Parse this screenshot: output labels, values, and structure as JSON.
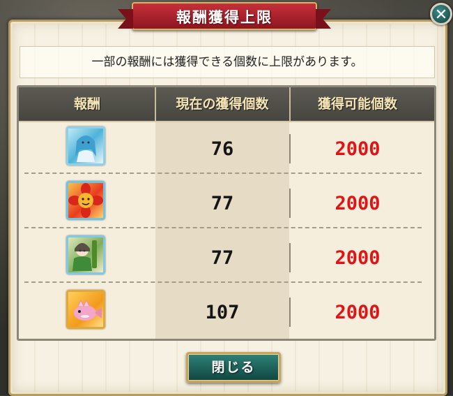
{
  "dialog": {
    "title": "報酬獲得上限",
    "notice": "一部の報酬には獲得できる個数に上限があります。",
    "close_button_label": "閉じる",
    "close_icon": "close-icon"
  },
  "table": {
    "headers": {
      "reward": "報酬",
      "current": "現在の獲得個数",
      "max": "獲得可能個数"
    },
    "rows": [
      {
        "icon": "blue-haired-maiden-card-icon",
        "current": "76",
        "max": "2000"
      },
      {
        "icon": "red-flower-creature-card-icon",
        "current": "77",
        "max": "2000"
      },
      {
        "icon": "green-hooded-girl-card-icon",
        "current": "77",
        "max": "2000"
      },
      {
        "icon": "pink-fish-creature-card-icon",
        "current": "107",
        "max": "2000"
      }
    ]
  },
  "colors": {
    "ribbon": "#b2222c",
    "header_bg": "#514e48",
    "header_text": "#f4e4b6",
    "max_value": "#e01414",
    "button": "#1f6a61"
  }
}
